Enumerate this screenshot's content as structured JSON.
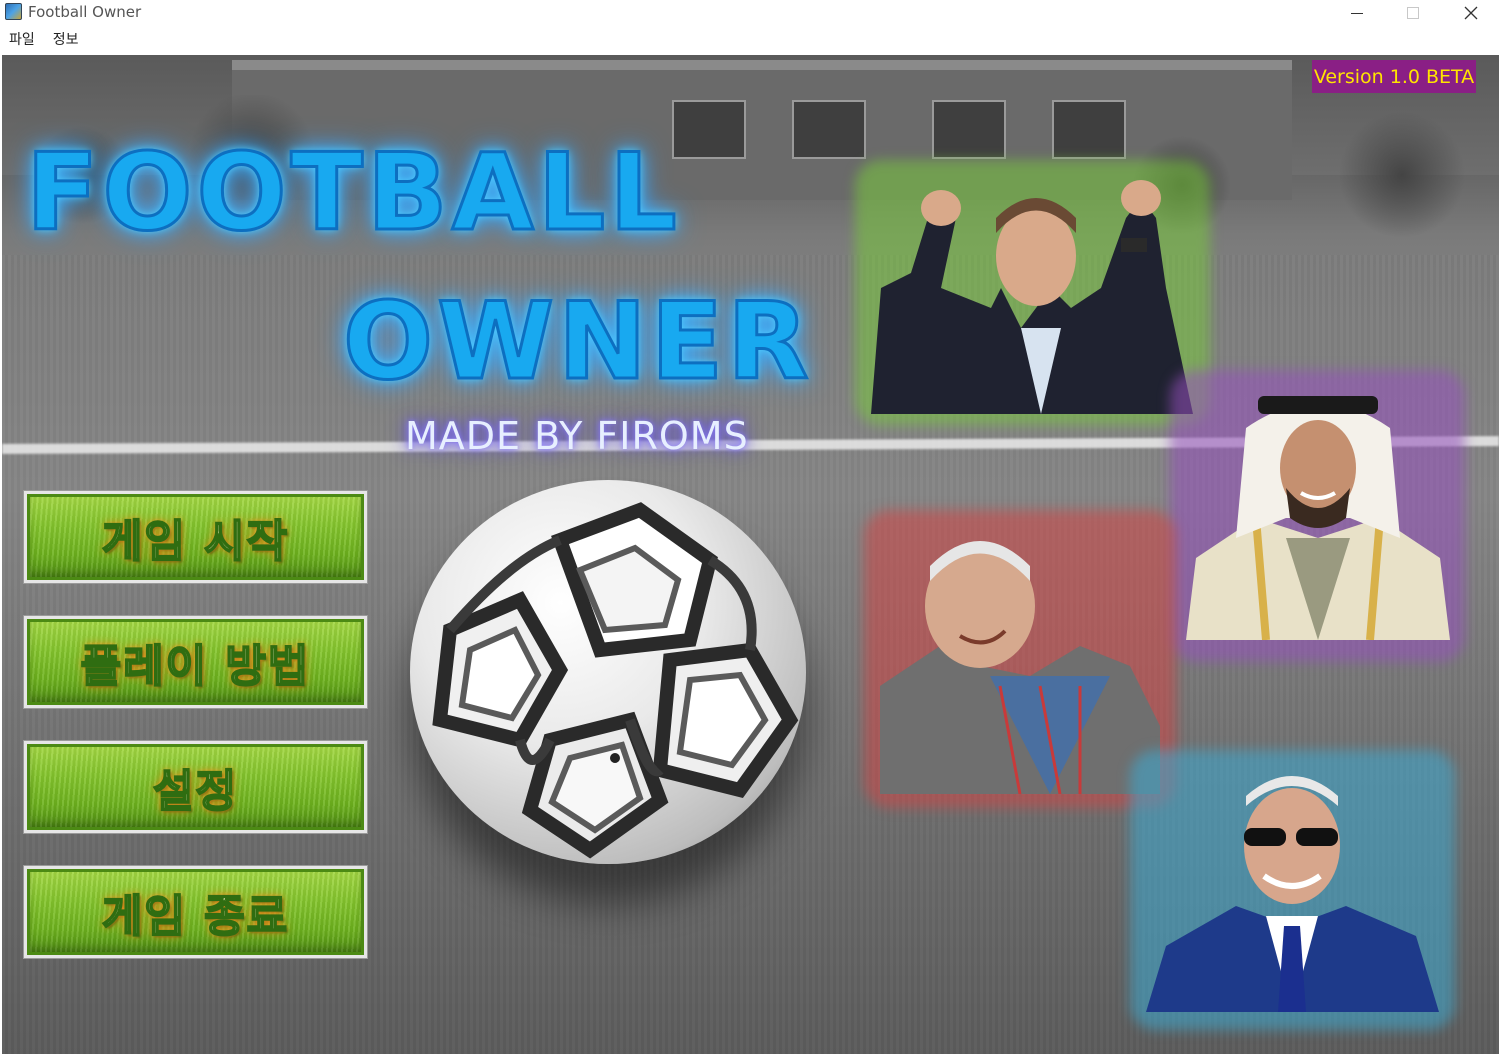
{
  "window": {
    "title": "Football Owner",
    "icon": "app-icon"
  },
  "menubar": {
    "items": [
      "파일",
      "정보"
    ]
  },
  "version": "Version 1.0 BETA",
  "title": {
    "line1": "FOOTBALL",
    "line2": "OWNER",
    "subtitle": "MADE BY FIROMS"
  },
  "buttons": {
    "start": "게임 시작",
    "how_to_play": "플레이 방법",
    "settings": "설정",
    "quit": "게임 종료"
  },
  "colors": {
    "title": "#18a9f0",
    "version_bg": "#8a1f85",
    "version_text": "#ffe400",
    "button_green": "#7cc02a",
    "glow_green": "#78c83c",
    "glow_purple": "#9650be",
    "glow_red": "#d24646",
    "glow_blue": "#3caad2"
  }
}
